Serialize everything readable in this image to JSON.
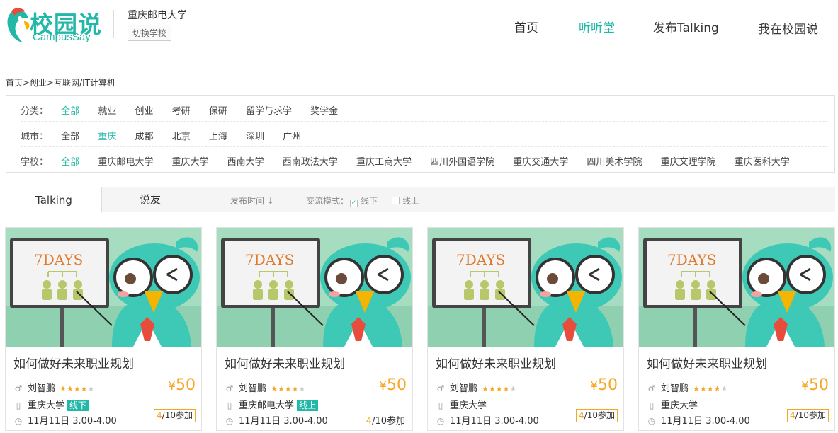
{
  "header": {
    "logo_cn": "校园说",
    "logo_en": "CampusSay",
    "school_name": "重庆邮电大学",
    "switch_label": "切换学校",
    "nav": [
      {
        "label": "首页"
      },
      {
        "label": "听听堂"
      },
      {
        "label": "发布Talking"
      },
      {
        "label": "我在校园说"
      }
    ]
  },
  "breadcrumb": "首页>创业>互联网/IT计算机",
  "filters": {
    "category": {
      "label": "分类：",
      "options": [
        "全部",
        "就业",
        "创业",
        "考研",
        "保研",
        "留学与求学",
        "奖学金"
      ]
    },
    "city": {
      "label": "城市：",
      "options": [
        "全部",
        "重庆",
        "成都",
        "北京",
        "上海",
        "深圳",
        "广州"
      ]
    },
    "school": {
      "label": "学校：",
      "options": [
        "全部",
        "重庆邮电大学",
        "重庆大学",
        "西南大学",
        "西南政法大学",
        "重庆工商大学",
        "四川外国语学院",
        "重庆交通大学",
        "四川美术学院",
        "重庆文理学院",
        "重庆医科大学"
      ]
    }
  },
  "tabs": {
    "talking": "Talking",
    "friends": "说友",
    "sort_time": "发布时间 ↓",
    "mode_label": "交流模式：",
    "offline": "线下",
    "online": "线上",
    "check_mark": "✓"
  },
  "cards": [
    {
      "title": "如何做好未来职业规划",
      "author": "刘智鹏",
      "rating": 4,
      "currency": "¥",
      "price": "50",
      "school": "重庆大学",
      "badge": "线下",
      "time": "11月11日  3.00-4.00",
      "joined": "4",
      "total": "/10参加",
      "image_text": "7DAYS"
    },
    {
      "title": "如何做好未来职业规划",
      "author": "刘智鹏",
      "rating": 4,
      "currency": "¥",
      "price": "50",
      "school": "重庆邮电大学",
      "badge": "线上",
      "time": "11月11日  3.00-4.00",
      "joined": "4",
      "total": "/10参加",
      "image_text": "7DAYS"
    },
    {
      "title": "如何做好未来职业规划",
      "author": "刘智鹏",
      "rating": 4,
      "currency": "¥",
      "price": "50",
      "school": "重庆大学",
      "badge": "",
      "time": "11月11日  3.00-4.00",
      "joined": "4",
      "total": "/10参加",
      "image_text": "7DAYS"
    },
    {
      "title": "如何做好未来职业规划",
      "author": "刘智鹏",
      "rating": 4,
      "currency": "¥",
      "price": "50",
      "school": "重庆大学",
      "badge": "",
      "time": "11月11日  3.00-4.00",
      "joined": "4",
      "total": "/10参加",
      "image_text": "7DAYS"
    }
  ],
  "colors": {
    "accent": "#22b8a8",
    "price": "#f5a623"
  }
}
